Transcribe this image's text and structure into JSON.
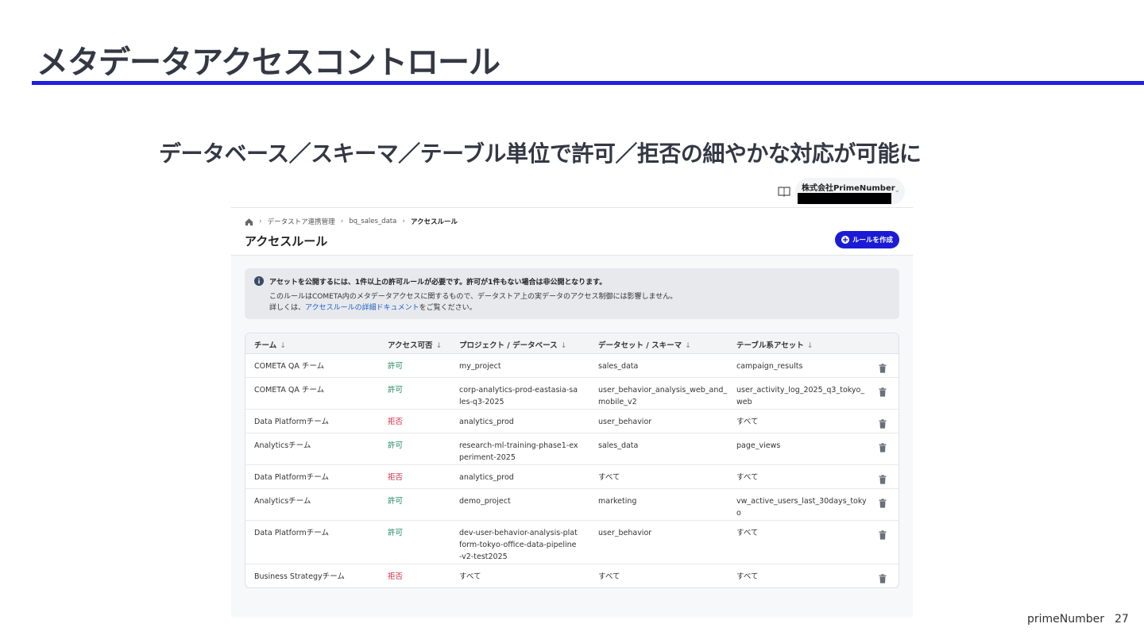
{
  "slide": {
    "title": "メタデータアクセスコントロール",
    "subtitle": "データベース／スキーマ／テーブル単位で許可／拒否の細やかな対応が可能に",
    "footer_brand": "primeNumber",
    "page_number": "27",
    "accent_color": "#1f1fe0"
  },
  "app": {
    "org_name": "株式会社PrimeNumber",
    "breadcrumb": {
      "items": [
        "データストア連携管理",
        "bq_sales_data"
      ],
      "current": "アクセスルール"
    },
    "page_heading": "アクセスルール",
    "create_button_label": "ルールを作成",
    "brand_color": "#1b1bd6",
    "info": {
      "line1": "アセットを公開するには、1件以上の許可ルールが必要です。許可が1件もない場合は非公開となります。",
      "line2": "このルールはCOMETA内のメタデータアクセスに関するもので、データストア上の実データのアクセス制御には影響しません。",
      "line3_prefix": "詳しくは、",
      "line3_link": "アクセスルールの詳細ドキュメント",
      "line3_suffix": "をご覧ください。"
    },
    "table": {
      "headers": {
        "team": "チーム",
        "access": "アクセス可否",
        "project": "プロジェクト / データベース",
        "dataset": "データセット / スキーマ",
        "table_asset": "テーブル系アセット"
      },
      "allow_color": "#1d8a5c",
      "deny_color": "#d0283f",
      "rows": [
        {
          "team": "COMETA QA チーム",
          "access": "許可",
          "project": "my_project",
          "dataset": "sales_data",
          "table_asset": "campaign_results"
        },
        {
          "team": "COMETA QA チーム",
          "access": "許可",
          "project": "corp-analytics-prod-eastasia-sales-q3-2025",
          "dataset": "user_behavior_analysis_web_and_mobile_v2",
          "table_asset": "user_activity_log_2025_q3_tokyo_web"
        },
        {
          "team": "Data Platformチーム",
          "access": "拒否",
          "project": "analytics_prod",
          "dataset": "user_behavior",
          "table_asset": "すべて"
        },
        {
          "team": "Analyticsチーム",
          "access": "許可",
          "project": "research-ml-training-phase1-experiment-2025",
          "dataset": "sales_data",
          "table_asset": "page_views"
        },
        {
          "team": "Data Platformチーム",
          "access": "拒否",
          "project": "analytics_prod",
          "dataset": "すべて",
          "table_asset": "すべて"
        },
        {
          "team": "Analyticsチーム",
          "access": "許可",
          "project": "demo_project",
          "dataset": "marketing",
          "table_asset": "vw_active_users_last_30days_tokyo"
        },
        {
          "team": "Data Platformチーム",
          "access": "許可",
          "project": "dev-user-behavior-analysis-platform-tokyo-office-data-pipeline-v2-test2025",
          "dataset": "user_behavior",
          "table_asset": "すべて"
        },
        {
          "team": "Business Strategyチーム",
          "access": "拒否",
          "project": "すべて",
          "dataset": "すべて",
          "table_asset": "すべて"
        }
      ]
    }
  }
}
